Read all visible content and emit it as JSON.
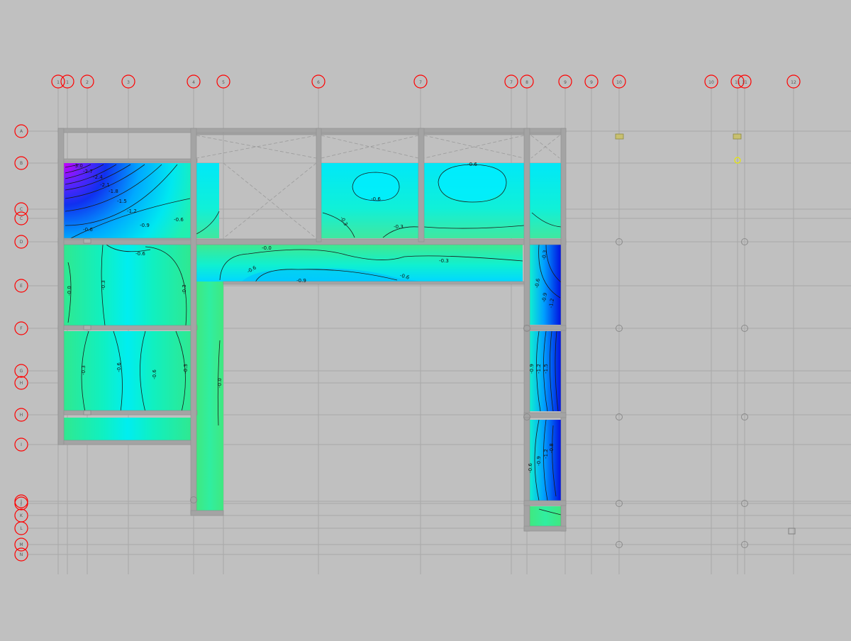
{
  "colors": {
    "background": "#c0c0c0",
    "grid_line": "#a8a8a8",
    "grid_bubble": "#ff0000",
    "beam": "#a4a4a4",
    "contour_line": "#1a1a1a",
    "marker": "#e8e800"
  },
  "grid": {
    "columns": [
      {
        "id": "c-1",
        "label": "1"
      },
      {
        "id": "c-1a",
        "label": "1"
      },
      {
        "id": "c-2",
        "label": "2"
      },
      {
        "id": "c-3",
        "label": "3"
      },
      {
        "id": "c-4",
        "label": "4"
      },
      {
        "id": "c-5",
        "label": "5"
      },
      {
        "id": "c-6",
        "label": "6"
      },
      {
        "id": "c-7",
        "label": "7"
      },
      {
        "id": "c-7a",
        "label": "7"
      },
      {
        "id": "c-8",
        "label": "8"
      },
      {
        "id": "c-9",
        "label": "9"
      },
      {
        "id": "c-9a",
        "label": "9"
      },
      {
        "id": "c-10",
        "label": "10"
      },
      {
        "id": "c-10a",
        "label": "10"
      },
      {
        "id": "c-11",
        "label": "11"
      },
      {
        "id": "c-11a",
        "label": "11"
      },
      {
        "id": "c-12",
        "label": "12"
      }
    ],
    "rows": [
      {
        "id": "r-a",
        "label": "A"
      },
      {
        "id": "r-b",
        "label": "B"
      },
      {
        "id": "r-c",
        "label": "C"
      },
      {
        "id": "r-c1",
        "label": "C"
      },
      {
        "id": "r-d",
        "label": "D"
      },
      {
        "id": "r-e",
        "label": "E"
      },
      {
        "id": "r-f",
        "label": "F"
      },
      {
        "id": "r-g",
        "label": "G"
      },
      {
        "id": "r-h",
        "label": "H"
      },
      {
        "id": "r-h1",
        "label": "H"
      },
      {
        "id": "r-i",
        "label": "I"
      },
      {
        "id": "r-j",
        "label": "J"
      },
      {
        "id": "r-j1",
        "label": "J"
      },
      {
        "id": "r-k",
        "label": "K"
      },
      {
        "id": "r-l",
        "label": "L"
      },
      {
        "id": "r-m",
        "label": "M"
      },
      {
        "id": "r-n",
        "label": "N"
      }
    ]
  },
  "contours": {
    "labels": [
      {
        "id": "lb1",
        "text": "-3.0"
      },
      {
        "id": "lb2",
        "text": "-2.7"
      },
      {
        "id": "lb3",
        "text": "-2.4"
      },
      {
        "id": "lb4",
        "text": "-2.1"
      },
      {
        "id": "lb5",
        "text": "-1.8"
      },
      {
        "id": "lb6",
        "text": "-1.5"
      },
      {
        "id": "lb7",
        "text": "-1.2"
      },
      {
        "id": "lb8",
        "text": "-0.9"
      },
      {
        "id": "lb9",
        "text": "-0.6"
      },
      {
        "id": "lb10",
        "text": "-0.6"
      },
      {
        "id": "lb11",
        "text": "-0.6"
      },
      {
        "id": "lb12",
        "text": "-0.6"
      },
      {
        "id": "lb13",
        "text": "-0.6"
      },
      {
        "id": "lb14",
        "text": "-0.3"
      },
      {
        "id": "lb15",
        "text": "-0.3"
      },
      {
        "id": "lb16",
        "text": "-0.3"
      },
      {
        "id": "lb17",
        "text": "-0.0"
      },
      {
        "id": "lb18",
        "text": "-0.3"
      },
      {
        "id": "lb19",
        "text": "-0.3"
      },
      {
        "id": "lb20",
        "text": "-0.6"
      },
      {
        "id": "lb21",
        "text": "-0.9"
      },
      {
        "id": "lb22",
        "text": "-0.6"
      },
      {
        "id": "lb23",
        "text": "-0.3"
      },
      {
        "id": "lb24",
        "text": "-0.0"
      },
      {
        "id": "lb25",
        "text": "-0.3"
      },
      {
        "id": "lb26",
        "text": "-0.6"
      },
      {
        "id": "lb27",
        "text": "-0.6"
      },
      {
        "id": "lb28",
        "text": "-0.3"
      },
      {
        "id": "lb29",
        "text": "-0.0"
      },
      {
        "id": "lb30",
        "text": "-0.6"
      },
      {
        "id": "lb31",
        "text": "-0.9"
      },
      {
        "id": "lb32",
        "text": "-1.2"
      },
      {
        "id": "lb33",
        "text": "-0.9"
      },
      {
        "id": "lb34",
        "text": "-1.2"
      },
      {
        "id": "lb35",
        "text": "-1.5"
      },
      {
        "id": "lb36",
        "text": "-0.6"
      },
      {
        "id": "lb37",
        "text": "-0.9"
      },
      {
        "id": "lb38",
        "text": "-1.2"
      },
      {
        "id": "lb39",
        "text": "-0.8"
      }
    ]
  }
}
